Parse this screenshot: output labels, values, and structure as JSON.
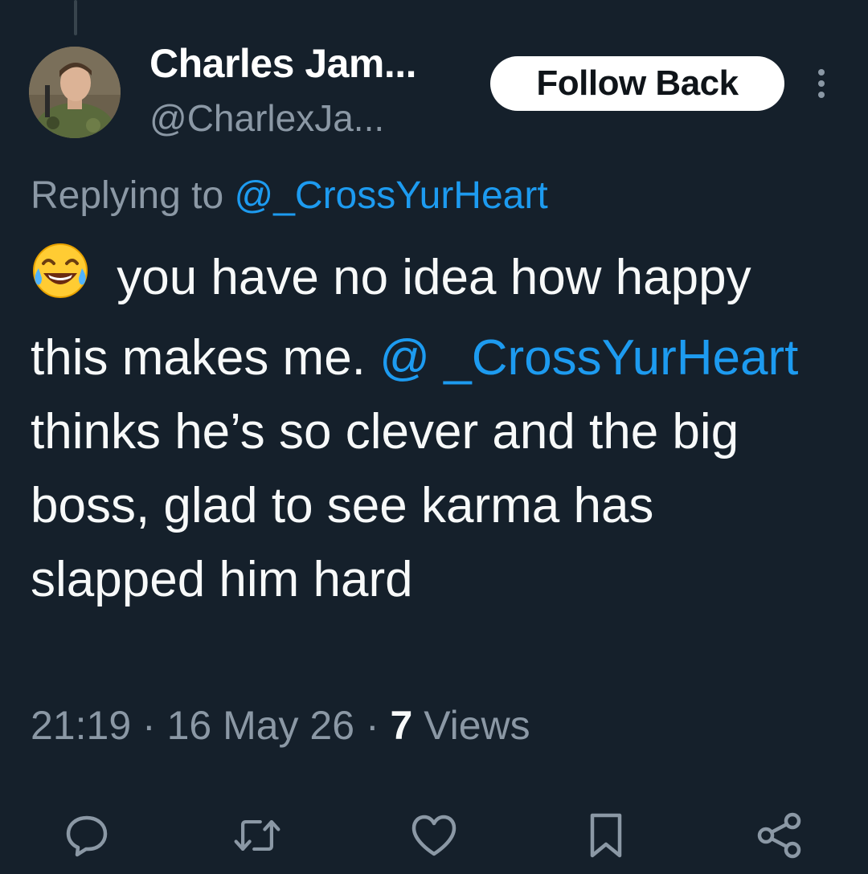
{
  "author": {
    "display_name": "Charles Jam...",
    "handle": "@CharlexJa...",
    "avatar": "profile-photo"
  },
  "follow_button": {
    "label": "Follow Back"
  },
  "reply_context": {
    "prefix": "Replying to ",
    "mention": "@_CrossYurHeart"
  },
  "tweet": {
    "emoji": "face-with-tears-of-joy",
    "text_part1": " you have no idea how happy this makes me. ",
    "mention": "@ _CrossYurHeart",
    "text_part2": " thinks he’s so clever and the big boss, glad to see karma has slapped him hard"
  },
  "meta": {
    "time": "21:19",
    "separator": " · ",
    "date": "16 May 26",
    "views_count": "7",
    "views_label": " Views"
  },
  "actions": [
    {
      "name": "reply",
      "icon": "reply-icon"
    },
    {
      "name": "retweet",
      "icon": "retweet-icon"
    },
    {
      "name": "like",
      "icon": "heart-icon"
    },
    {
      "name": "bookmark",
      "icon": "bookmark-icon"
    },
    {
      "name": "share",
      "icon": "share-icon"
    }
  ],
  "colors": {
    "background": "#15202b",
    "text": "#f7f9f9",
    "secondary": "#8b98a5",
    "accent": "#1d9bf0",
    "button_bg": "#ffffff"
  }
}
